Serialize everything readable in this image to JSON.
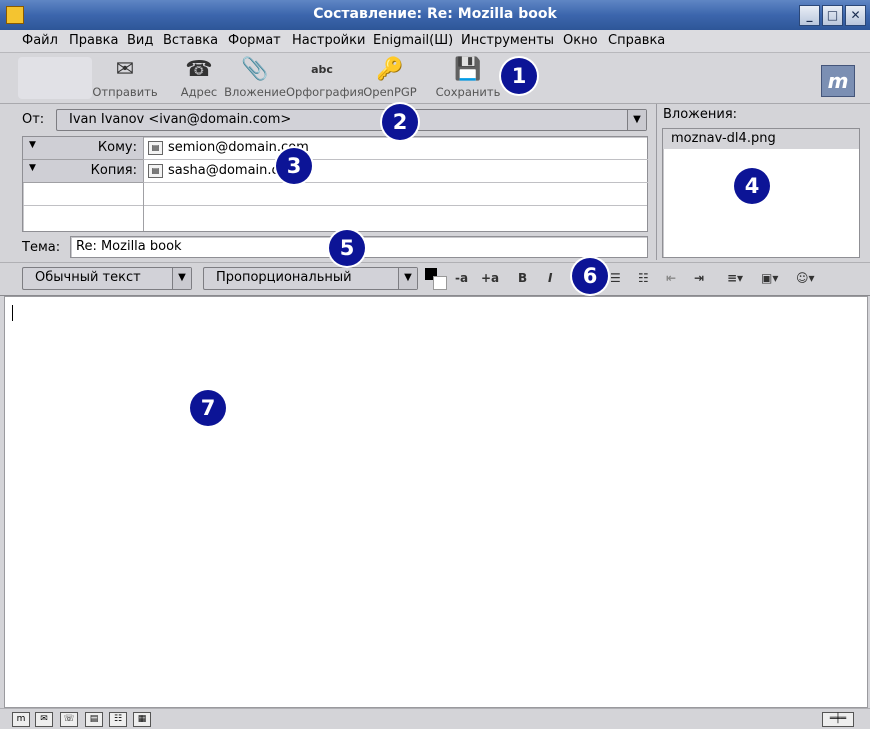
{
  "window": {
    "title": "Составление: Re: Mozilla book"
  },
  "menu": [
    "Файл",
    "Правка",
    "Вид",
    "Вставка",
    "Формат",
    "Настройки",
    "Enigmail(Ш)",
    "Инструменты",
    "Окно",
    "Справка"
  ],
  "toolbar": {
    "send": "Отправить",
    "address": "Адрес",
    "attach": "Вложение",
    "spell": "Орфография",
    "openpgp": "OpenPGP",
    "save": "Сохранить"
  },
  "from": {
    "label": "От:",
    "value": "Ivan Ivanov <ivan@domain.com>"
  },
  "recipients": [
    {
      "type": "Кому:",
      "address": "semion@domain.com"
    },
    {
      "type": "Копия:",
      "address": "sasha@domain.com"
    }
  ],
  "subject": {
    "label": "Тема:",
    "value": "Re: Mozilla book"
  },
  "attachments": {
    "label": "Вложения:",
    "items": [
      "moznav-dl4.png"
    ]
  },
  "format": {
    "paragraph": "Обычный текст",
    "font": "Пропорциональный"
  },
  "callouts": [
    "1",
    "2",
    "3",
    "4",
    "5",
    "6",
    "7"
  ],
  "colors": {
    "title_bar": "#3c66ad",
    "callout": "#0c1496",
    "selection": "#d4d4d8"
  }
}
